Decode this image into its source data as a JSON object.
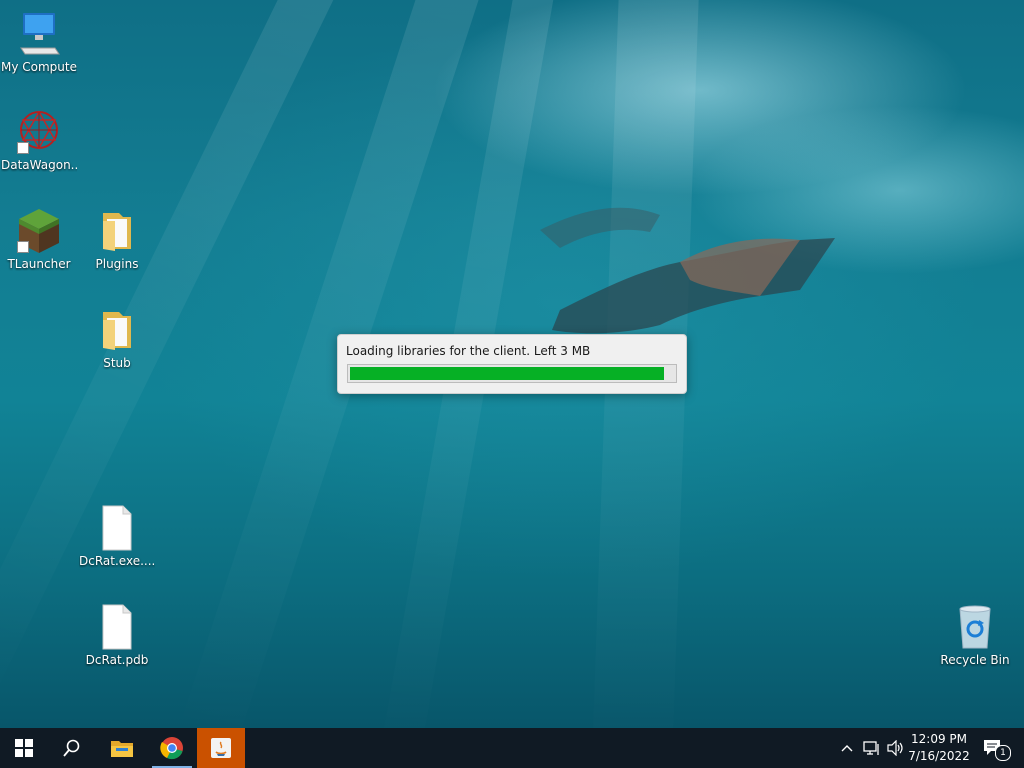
{
  "desktop": {
    "icons": [
      {
        "label": "My Computer",
        "icon": "computer-icon"
      },
      {
        "label": "DataWagon...",
        "icon": "datawagon-icon",
        "shortcut": true
      },
      {
        "label": "TLauncher",
        "icon": "minecraft-grass-block-icon",
        "shortcut": true
      },
      {
        "label": "Plugins",
        "icon": "folder-icon"
      },
      {
        "label": "Stub",
        "icon": "folder-icon"
      },
      {
        "label": "DcRat.exe....",
        "icon": "blank-file-icon"
      },
      {
        "label": "DcRat.pdb",
        "icon": "blank-file-icon"
      },
      {
        "label": "Recycle Bin",
        "icon": "recycle-bin-icon"
      }
    ]
  },
  "loader": {
    "message": "Loading libraries for the client. Left 3 MB",
    "progress": 0.97,
    "bar_color": "#06b025"
  },
  "taskbar": {
    "apps": [
      {
        "name": "start",
        "icon": "windows-logo-icon"
      },
      {
        "name": "search",
        "icon": "search-icon"
      },
      {
        "name": "file-explorer",
        "icon": "folder-icon"
      },
      {
        "name": "chrome",
        "icon": "chrome-icon"
      },
      {
        "name": "java",
        "icon": "java-icon",
        "active": true
      }
    ],
    "tray": {
      "icons": [
        "chevron-up-icon",
        "network-icon",
        "volume-icon"
      ],
      "time": "12:09 PM",
      "date": "7/16/2022",
      "notification_count": "1"
    },
    "accent": "#ca5100",
    "background": "#101a24"
  }
}
